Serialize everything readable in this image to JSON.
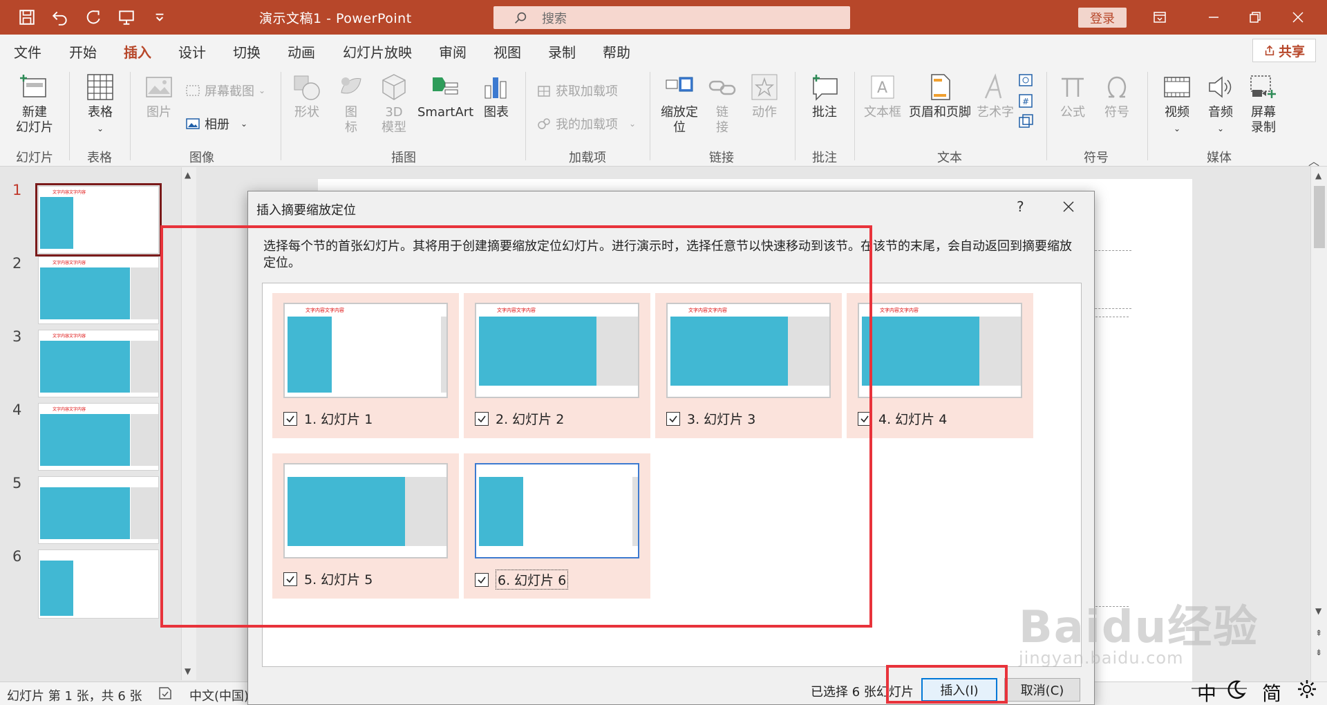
{
  "titlebar": {
    "doc_title": "演示文稿1  -  PowerPoint",
    "search_placeholder": "搜索",
    "login": "登录"
  },
  "tabs": [
    "文件",
    "开始",
    "插入",
    "设计",
    "切换",
    "动画",
    "幻灯片放映",
    "审阅",
    "视图",
    "录制",
    "帮助"
  ],
  "active_tab": "插入",
  "share": "共享",
  "ribbon": {
    "new_slide": "新建\n幻灯片",
    "table": "表格",
    "picture": "图片",
    "screenshot": "屏幕截图",
    "album": "相册",
    "shapes": "形状",
    "icons": "图\n标",
    "model3d": "3D\n模型",
    "smartart": "SmartArt",
    "chart": "图表",
    "get_addins": "获取加载项",
    "my_addins": "我的加载项",
    "zoom": "缩放定\n位",
    "link": "链\n接",
    "action": "动作",
    "comment": "批注",
    "textbox": "文本框",
    "header_footer": "页眉和页脚",
    "wordart": "艺术字",
    "equation": "公式",
    "symbol": "符号",
    "video": "视频",
    "audio": "音频",
    "screen_record": "屏幕\n录制",
    "groups": {
      "slides": "幻灯片",
      "tables": "表格",
      "images": "图像",
      "illustrations": "插图",
      "addins": "加载项",
      "links": "链接",
      "comments": "批注",
      "text": "文本",
      "symbols": "符号",
      "media": "媒体"
    }
  },
  "slides": [
    "1",
    "2",
    "3",
    "4",
    "5",
    "6"
  ],
  "slide_title_text": "文字内容文字内容",
  "statusbar": {
    "slide_info": "幻灯片 第 1 张，共 6 张",
    "language": "中文(中国)"
  },
  "dialog": {
    "title": "插入摘要缩放定位",
    "help": "?",
    "description": "选择每个节的首张幻灯片。其将用于创建摘要缩放定位幻灯片。进行演示时，选择任意节以快速移动到该节。在该节的末尾，会自动返回到摘要缩放定位。",
    "items": [
      {
        "label": "1. 幻灯片 1",
        "checked": true
      },
      {
        "label": "2. 幻灯片 2",
        "checked": true
      },
      {
        "label": "3. 幻灯片 3",
        "checked": true
      },
      {
        "label": "4. 幻灯片 4",
        "checked": true
      },
      {
        "label": "5. 幻灯片 5",
        "checked": true
      },
      {
        "label": "6. 幻灯片 6",
        "checked": true
      }
    ],
    "thumb_title": "文字内容文字内容",
    "selected_count": "已选择 6 张幻灯片",
    "insert": "插入(I)",
    "cancel": "取消(C)"
  },
  "ime": {
    "mode1": "中",
    "mode3": "简"
  },
  "watermark": {
    "main": "Baidu经验",
    "sub": "jingyan.baidu.com"
  },
  "colors": {
    "accent": "#b7472a",
    "thumb_blue": "#41b8d3",
    "highlight_red": "#e8333b",
    "item_bg": "#fbe3dc"
  }
}
